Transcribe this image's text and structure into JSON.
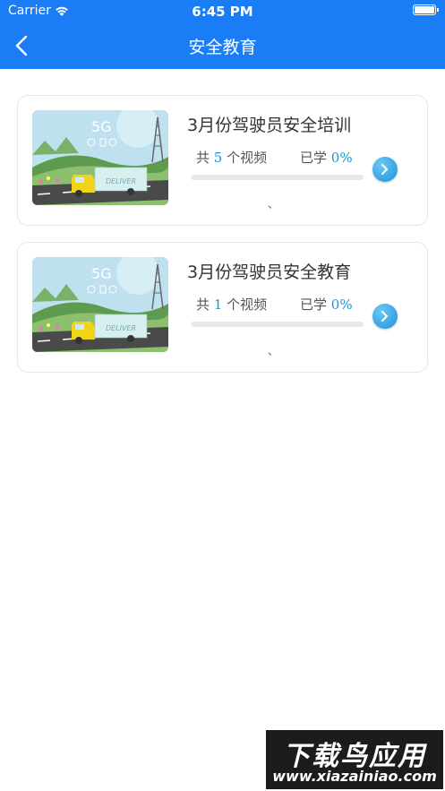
{
  "status_bar": {
    "carrier": "Carrier",
    "time": "6:45 PM",
    "icons": [
      "wifi-icon",
      "battery-icon"
    ]
  },
  "nav": {
    "title": "安全教育",
    "back_icon": "chevron-left-icon",
    "background_color": "#1a7df6"
  },
  "courses": [
    {
      "title": "3月份驾驶员安全培训",
      "count_prefix": "共",
      "count": "5",
      "count_suffix": "个视频",
      "learned_label": "已学",
      "learned_value": "0%",
      "progress": 0,
      "mark": "、",
      "thumbnail_text": {
        "network": "5G",
        "truck": "DELIVER"
      }
    },
    {
      "title": "3月份驾驶员安全教育",
      "count_prefix": "共",
      "count": "1",
      "count_suffix": "个视频",
      "learned_label": "已学",
      "learned_value": "0%",
      "progress": 0,
      "mark": "、",
      "thumbnail_text": {
        "network": "5G",
        "truck": "DELIVER"
      }
    }
  ],
  "accent_color": "#1a94d6",
  "watermark": {
    "text": "下载鸟应用",
    "url": "www.xiazainiao.com"
  }
}
